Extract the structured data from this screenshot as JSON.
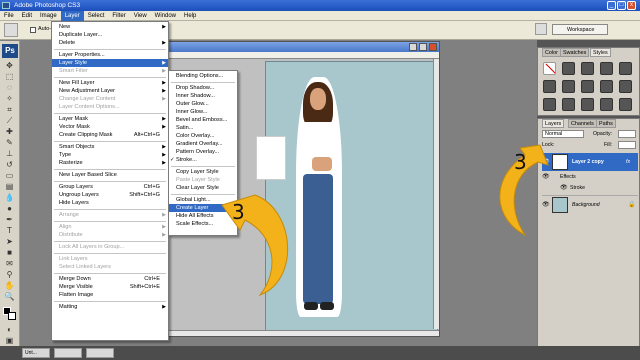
{
  "window": {
    "title": "Adobe Photoshop CS3",
    "minimize": "_",
    "maximize": "□",
    "close": "x"
  },
  "menubar": [
    "File",
    "Edit",
    "Image",
    "Layer",
    "Select",
    "Filter",
    "View",
    "Window",
    "Help"
  ],
  "options": {
    "auto_select_label": "Auto-Se",
    "workspace_label": "Workspace"
  },
  "layer_menu": {
    "items": [
      {
        "label": "New"
      },
      {
        "label": "Duplicate Layer..."
      },
      {
        "label": "Delete"
      },
      {
        "label": "Layer Properties..."
      },
      {
        "label": "Layer Style"
      },
      {
        "label": "Smart Filter"
      },
      {
        "label": "New Fill Layer"
      },
      {
        "label": "New Adjustment Layer"
      },
      {
        "label": "Change Layer Content"
      },
      {
        "label": "Layer Content Options..."
      },
      {
        "label": "Layer Mask"
      },
      {
        "label": "Vector Mask"
      },
      {
        "label": "Create Clipping Mask",
        "shortcut": "Alt+Ctrl+G"
      },
      {
        "label": "Smart Objects"
      },
      {
        "label": "Type"
      },
      {
        "label": "Rasterize"
      },
      {
        "label": "New Layer Based Slice"
      },
      {
        "label": "Group Layers",
        "shortcut": "Ctrl+G"
      },
      {
        "label": "Ungroup Layers",
        "shortcut": "Shift+Ctrl+G"
      },
      {
        "label": "Hide Layers"
      },
      {
        "label": "Arrange"
      },
      {
        "label": "Align"
      },
      {
        "label": "Distribute"
      },
      {
        "label": "Lock All Layers in Group..."
      },
      {
        "label": "Link Layers"
      },
      {
        "label": "Select Linked Layers"
      },
      {
        "label": "Merge Down",
        "shortcut": "Ctrl+E"
      },
      {
        "label": "Merge Visible",
        "shortcut": "Shift+Ctrl+E"
      },
      {
        "label": "Flatten Image"
      },
      {
        "label": "Matting"
      }
    ]
  },
  "layer_style_menu": {
    "items": [
      {
        "label": "Blending Options..."
      },
      {
        "label": "Drop Shadow..."
      },
      {
        "label": "Inner Shadow..."
      },
      {
        "label": "Outer Glow..."
      },
      {
        "label": "Inner Glow..."
      },
      {
        "label": "Bevel and Emboss..."
      },
      {
        "label": "Satin..."
      },
      {
        "label": "Color Overlay..."
      },
      {
        "label": "Gradient Overlay..."
      },
      {
        "label": "Pattern Overlay..."
      },
      {
        "label": "Stroke..."
      },
      {
        "label": "Copy Layer Style"
      },
      {
        "label": "Paste Layer Style"
      },
      {
        "label": "Clear Layer Style"
      },
      {
        "label": "Global Light..."
      },
      {
        "label": "Create Layer"
      },
      {
        "label": "Hide All Effects"
      },
      {
        "label": "Scale Effects..."
      }
    ]
  },
  "styles_panel": {
    "tabs": [
      "Color",
      "Swatches",
      "Styles"
    ]
  },
  "layers_panel": {
    "tabs": [
      "Layers",
      "Channels",
      "Paths"
    ],
    "blend_mode": "Normal",
    "opacity_label": "Opacity:",
    "fill_label": "Fill:",
    "lock_label": "Lock:",
    "layers": [
      {
        "name": "Layer 2 copy",
        "selected": true,
        "fx": "fx"
      },
      {
        "name": "Effects",
        "sub": true
      },
      {
        "name": "Stroke",
        "sub": true
      },
      {
        "name": "Background",
        "italic": true
      }
    ]
  },
  "taskbar": {
    "items": [
      "Unt...",
      "",
      ""
    ]
  },
  "annotations": [
    "3",
    "3"
  ],
  "colors": {
    "highlight": "#316ac5",
    "canvas_bg": "#a7c7cc",
    "arrow": "#f3b21a"
  }
}
